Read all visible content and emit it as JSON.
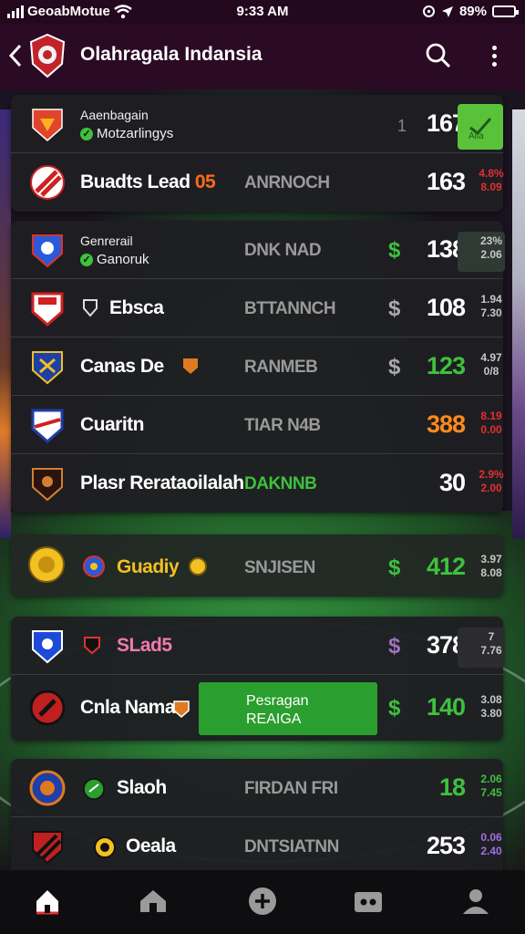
{
  "status_bar": {
    "carrier": "GeoabMotue",
    "time": "9:33 AM",
    "battery": "89%"
  },
  "header": {
    "title": "Olahragala Indansia"
  },
  "colors": {
    "header_bg": "#2b0a24",
    "card_bg": "#1e1e22",
    "accent_green": "#3ec13e",
    "orange": "#ff8a1a",
    "red": "#e03030"
  },
  "card1": {
    "rows": [
      {
        "top": "Aaenbagain",
        "bottom": "Motzarlingys",
        "score": "167",
        "prefix": "1",
        "check_label": "Alla"
      },
      {
        "name": "Buadts Lead",
        "name_hl": "05",
        "status": "ANRNOCH",
        "score": "163",
        "odds_a": "4.8%",
        "odds_b": "8.09"
      }
    ]
  },
  "card2": {
    "rows": [
      {
        "top": "Genrerail",
        "bottom": "Ganoruk",
        "status": "DNK NAD",
        "dollar": "$",
        "score": "138",
        "odds_a": "23%",
        "odds_b": "2.06"
      },
      {
        "name": "Ebsca",
        "status": "BTTANNCH",
        "dollar": "$",
        "score": "108",
        "odds_a": "1.94",
        "odds_b": "7.30"
      },
      {
        "name": "Canas De",
        "status": "RANMEB",
        "dollar": "$",
        "score": "123",
        "odds_a": "4.97",
        "odds_b": "0/8"
      },
      {
        "name": "Cuaritn",
        "status": "TIAR N4B",
        "score": "388",
        "odds_a": "8.19",
        "odds_b": "0.00"
      },
      {
        "name": "Plasr Rerataoilalah",
        "status": "DAKNNB",
        "score": "30",
        "odds_a": "2.9%",
        "odds_b": "2.00"
      }
    ]
  },
  "card3": {
    "rows": [
      {
        "name": "Guadiy",
        "status": "SNJISEN",
        "dollar": "$",
        "score": "412",
        "odds_a": "3.97",
        "odds_b": "8.08"
      }
    ]
  },
  "card4": {
    "rows": [
      {
        "name": "SLad5",
        "dollar": "$",
        "score": "378",
        "odds_a": "7",
        "odds_b": "7.76"
      },
      {
        "name": "Cnla Nama",
        "btn_l1": "Pesragan",
        "btn_l2": "REAIGA",
        "dollar": "$",
        "score": "140",
        "odds_a": "3.08",
        "odds_b": "3.80"
      }
    ]
  },
  "card5": {
    "rows": [
      {
        "name": "Slaoh",
        "status": "FIRDAN FRI",
        "score": "18",
        "odds_a": "2.06",
        "odds_b": "7.45"
      },
      {
        "name": "Oeala",
        "status": "DNTSIATNN",
        "score": "253",
        "odds_a": "0.06",
        "odds_b": "2.40"
      }
    ]
  },
  "nav": {
    "items": [
      "home",
      "stadium",
      "add",
      "tickets",
      "profile"
    ]
  }
}
